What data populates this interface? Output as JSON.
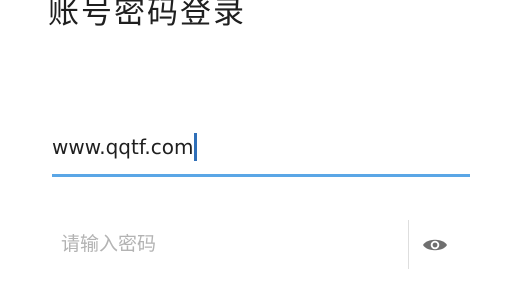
{
  "page": {
    "title": "账号密码登录"
  },
  "account_field": {
    "value": "www.qqtf.com"
  },
  "password_field": {
    "placeholder": "请输入密码",
    "toggle_icon": "eye-icon"
  },
  "colors": {
    "underline_focus": "#5aa6e6",
    "cursor": "#2f6fb8",
    "placeholder": "#b3b3b3",
    "icon": "#6f6f6f"
  }
}
